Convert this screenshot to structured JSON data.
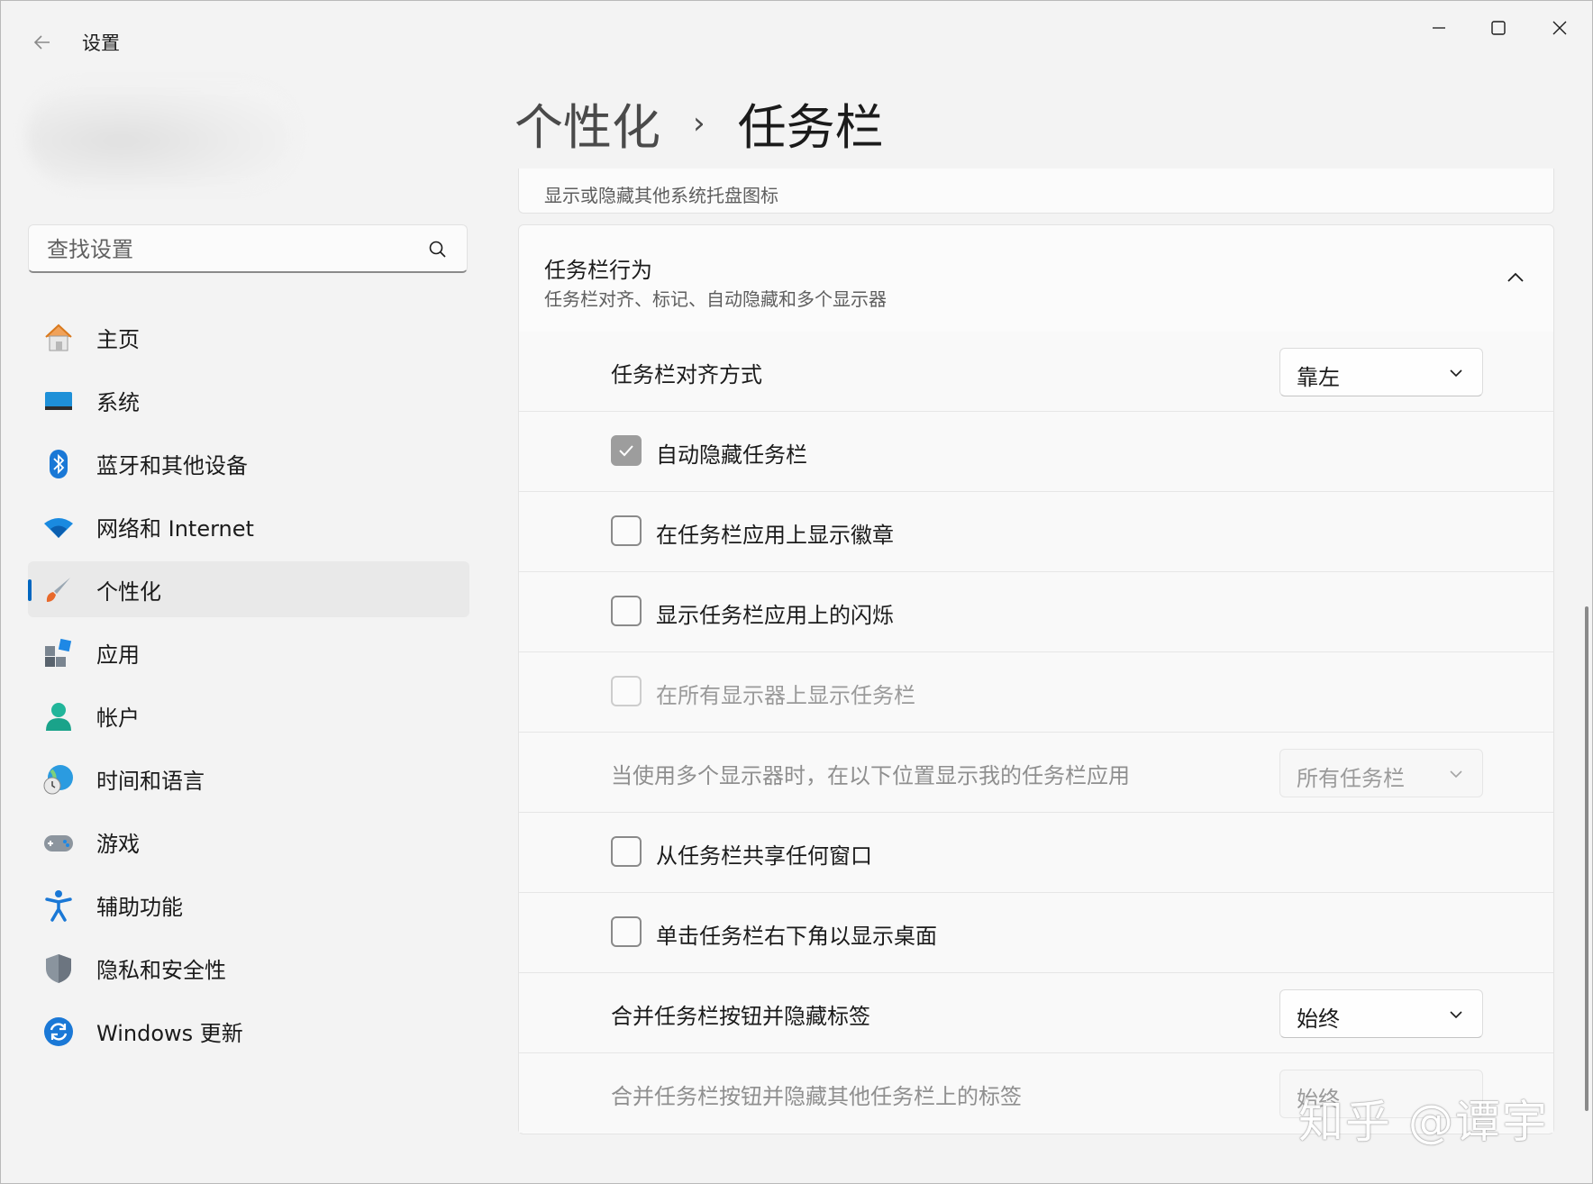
{
  "app": {
    "title": "设置"
  },
  "search": {
    "placeholder": "查找设置"
  },
  "sidebar": {
    "items": [
      {
        "label": "主页",
        "icon": "home-icon"
      },
      {
        "label": "系统",
        "icon": "system-icon"
      },
      {
        "label": "蓝牙和其他设备",
        "icon": "bluetooth-icon"
      },
      {
        "label": "网络和 Internet",
        "icon": "wifi-icon"
      },
      {
        "label": "个性化",
        "icon": "brush-icon",
        "selected": true
      },
      {
        "label": "应用",
        "icon": "apps-icon"
      },
      {
        "label": "帐户",
        "icon": "account-icon"
      },
      {
        "label": "时间和语言",
        "icon": "globe-clock-icon"
      },
      {
        "label": "游戏",
        "icon": "gamepad-icon"
      },
      {
        "label": "辅助功能",
        "icon": "accessibility-icon"
      },
      {
        "label": "隐私和安全性",
        "icon": "shield-icon"
      },
      {
        "label": "Windows 更新",
        "icon": "update-icon"
      }
    ]
  },
  "breadcrumb": {
    "parent": "个性化",
    "separator": "›",
    "current": "任务栏"
  },
  "top_card": {
    "subtitle": "显示或隐藏其他系统托盘图标"
  },
  "behaviors": {
    "title": "任务栏行为",
    "subtitle": "任务栏对齐、标记、自动隐藏和多个显示器",
    "alignment": {
      "label": "任务栏对齐方式",
      "value": "靠左"
    },
    "auto_hide": {
      "label": "自动隐藏任务栏",
      "checked": true
    },
    "badges": {
      "label": "在任务栏应用上显示徽章",
      "checked": false
    },
    "flashing": {
      "label": "显示任务栏应用上的闪烁",
      "checked": false
    },
    "all_displays": {
      "label": "在所有显示器上显示任务栏",
      "checked": false,
      "disabled": true
    },
    "multi_display": {
      "label": "当使用多个显示器时，在以下位置显示我的任务栏应用",
      "value": "所有任务栏",
      "disabled": true
    },
    "share_window": {
      "label": "从任务栏共享任何窗口",
      "checked": false
    },
    "show_desktop": {
      "label": "单击任务栏右下角以显示桌面",
      "checked": false
    },
    "combine": {
      "label": "合并任务栏按钮并隐藏标签",
      "value": "始终"
    },
    "combine_other": {
      "label": "合并任务栏按钮并隐藏其他任务栏上的标签",
      "value": "始终",
      "disabled": true
    }
  },
  "watermark": "知乎 @谭宇",
  "colors": {
    "accent": "#0067c0",
    "background": "#f3f3f3",
    "card": "#fbfbfb"
  }
}
